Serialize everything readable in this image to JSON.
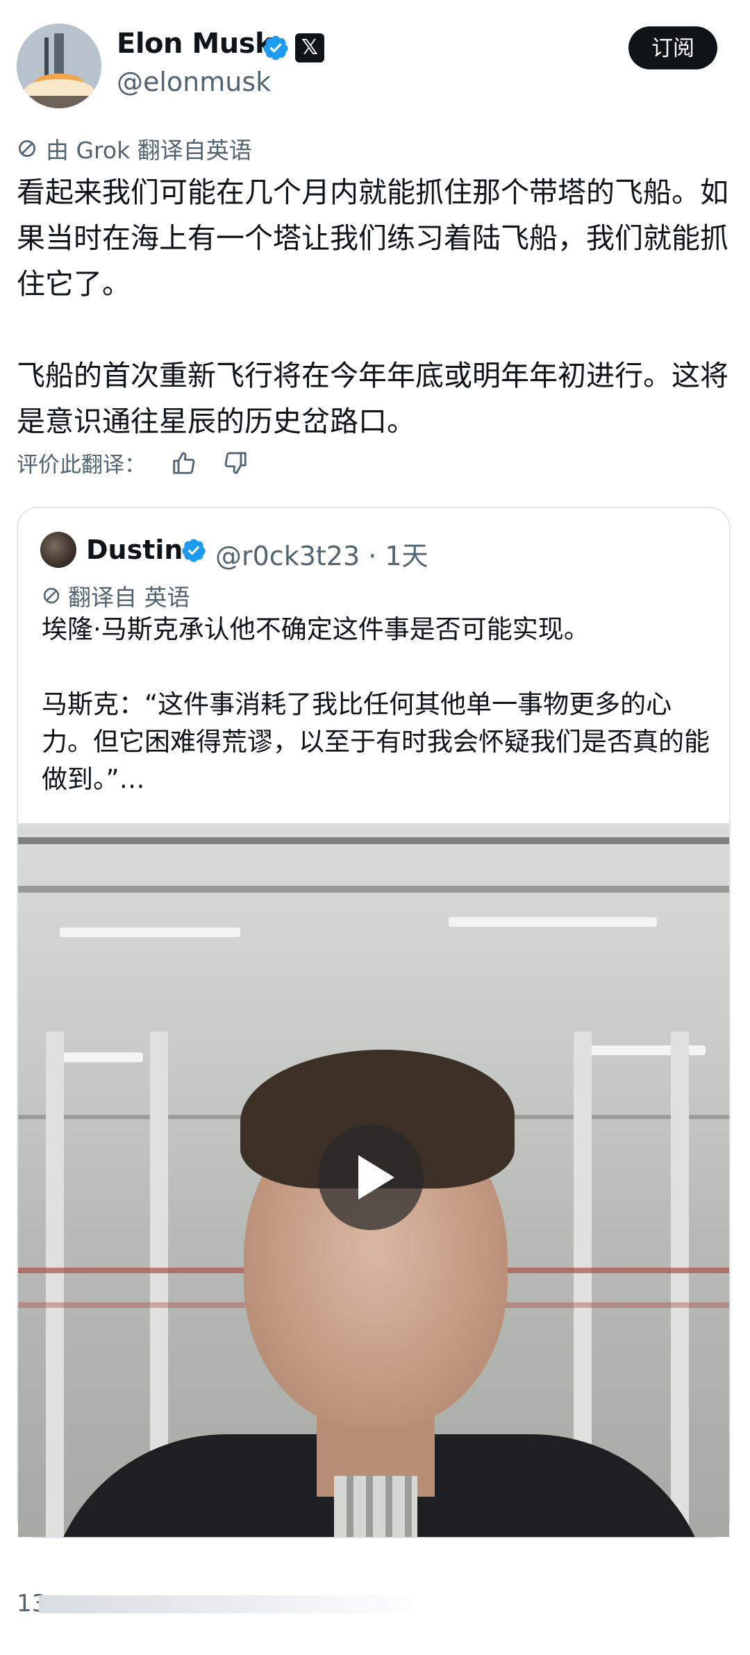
{
  "header": {
    "display_name": "Elon Musk",
    "handle": "@elonmusk",
    "x_badge": "𝕏",
    "subscribe_label": "订阅"
  },
  "translation": {
    "meta": "由 Grok 翻译自英语",
    "text": "看起来我们可能在几个月内就能抓住那个带塔的飞船。如果当时在海上有一个塔让我们练习着陆飞船，我们就能抓住它了。\n\n飞船的首次重新飞行将在今年年底或明年年初进行。这将是意识通往星辰的历史岔路口。",
    "rate_label": "评价此翻译："
  },
  "quote": {
    "display_name": "Dustin",
    "handle_time": "@r0ck3t23 · 1天",
    "translation_meta": "翻译自 英语",
    "text": "埃隆·马斯克承认他不确定这件事是否可能实现。\n\n马斯克：“这件事消耗了我比任何其他单一事物更多的心力。但它困难得荒谬，以至于有时我会怀疑我们是否真的能做到。”…"
  },
  "footer": {
    "count_partial": "13"
  },
  "colors": {
    "text_primary": "#0f1419",
    "text_secondary": "#536471",
    "verified_blue": "#1d9bf0",
    "border": "#e1e8ed"
  },
  "icons": [
    "verified-badge-icon",
    "x-logo-icon",
    "translate-icon",
    "thumbs-up-icon",
    "thumbs-down-icon",
    "play-icon"
  ]
}
